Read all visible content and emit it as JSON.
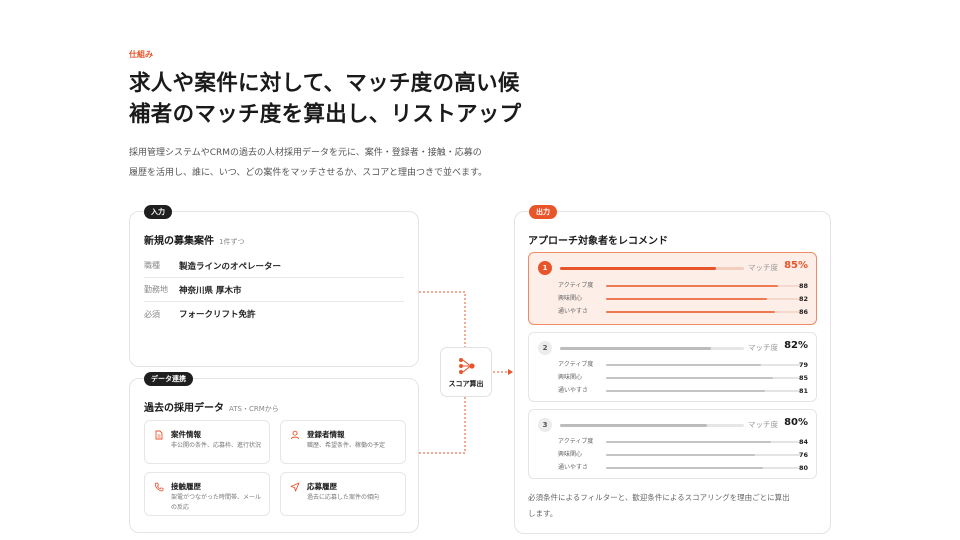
{
  "header": {
    "eyebrow": "仕組み",
    "headline_line1": "求人や案件に対して、マッチ度の高い候",
    "headline_line2": "補者のマッチ度を算出し、リストアップ",
    "lead_line1": "採用管理システムやCRMの過去の人材採用データを元に、案件・登録者・接触・応募の",
    "lead_line2": "履歴を活用し、誰に、いつ、どの案件をマッチさせるか、スコアと理由つきで並べます。"
  },
  "input_card": {
    "badge": "入力",
    "title": "新規の募集案件",
    "subtitle": "1件ずつ",
    "fields": [
      {
        "label": "職種",
        "value": "製造ラインのオペレーター"
      },
      {
        "label": "勤務地",
        "value": "神奈川県 厚木市"
      },
      {
        "label": "必須",
        "value": "フォークリフト免許"
      }
    ]
  },
  "data_card": {
    "badge": "データ連携",
    "title": "過去の採用データ",
    "subtitle": "ATS・CRMから",
    "sources": [
      {
        "icon": "document-icon",
        "title": "案件情報",
        "desc": "非公開の条件、応募枠、進行状況"
      },
      {
        "icon": "person-icon",
        "title": "登録者情報",
        "desc": "職歴、希望条件、稼働の予定"
      },
      {
        "icon": "phone-icon",
        "title": "接触履歴",
        "desc": "架電がつながった時間帯、メールの反応"
      },
      {
        "icon": "send-icon",
        "title": "応募履歴",
        "desc": "過去に応募した案件の傾向"
      }
    ]
  },
  "hub": {
    "icon": "network-icon",
    "label": "スコア算出"
  },
  "output_card": {
    "badge": "出力",
    "title": "アプローチ対象者をレコメンド",
    "score_label": "マッチ度",
    "candidates": [
      {
        "rank": "1",
        "score": "85%",
        "score_fraction": 0.85,
        "metrics": [
          {
            "label": "アクティブ度",
            "value": "88",
            "fraction": 0.88
          },
          {
            "label": "興味関心",
            "value": "82",
            "fraction": 0.82
          },
          {
            "label": "通いやすさ",
            "value": "86",
            "fraction": 0.86
          }
        ]
      },
      {
        "rank": "2",
        "score": "82%",
        "score_fraction": 0.82,
        "metrics": [
          {
            "label": "アクティブ度",
            "value": "79",
            "fraction": 0.79
          },
          {
            "label": "興味関心",
            "value": "85",
            "fraction": 0.85
          },
          {
            "label": "通いやすさ",
            "value": "81",
            "fraction": 0.81
          }
        ]
      },
      {
        "rank": "3",
        "score": "80%",
        "score_fraction": 0.8,
        "metrics": [
          {
            "label": "アクティブ度",
            "value": "84",
            "fraction": 0.84
          },
          {
            "label": "興味関心",
            "value": "76",
            "fraction": 0.76
          },
          {
            "label": "通いやすさ",
            "value": "80",
            "fraction": 0.8
          }
        ]
      }
    ],
    "footnote_line1": "必須条件によるフィルターと、歓迎条件によるスコアリングを理由ごとに算出",
    "footnote_line2": "します。"
  },
  "colors": {
    "accent": "#e8552b",
    "accent_light": "#fdeee8",
    "text": "#1a1a1a",
    "muted": "#888888"
  }
}
